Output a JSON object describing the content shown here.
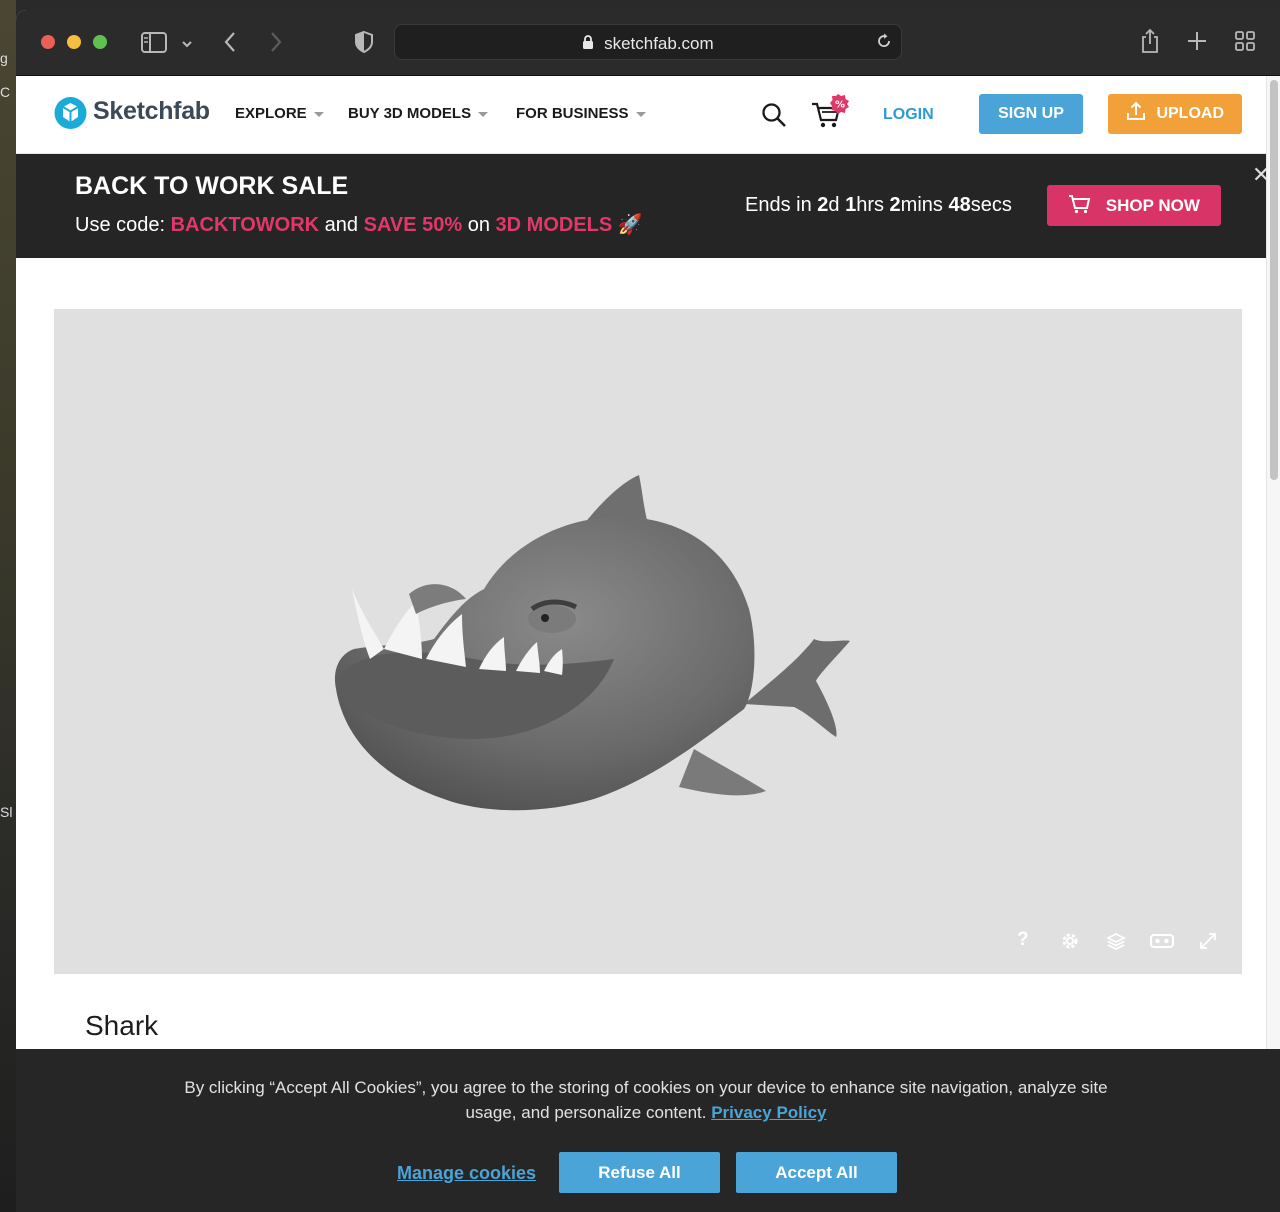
{
  "desktop": {
    "fragments": [
      "g",
      "C",
      "Sl"
    ]
  },
  "browser": {
    "url": "sketchfab.com",
    "colors": {
      "close": "#ec5f57",
      "minimize": "#f5be3f",
      "zoom": "#5fc24f"
    }
  },
  "header": {
    "logo_text": "Sketchfab",
    "nav": [
      {
        "label": "EXPLORE"
      },
      {
        "label": "BUY 3D MODELS"
      },
      {
        "label": "FOR BUSINESS"
      }
    ],
    "login_label": "LOGIN",
    "signup_label": "SIGN UP",
    "upload_label": "UPLOAD",
    "cart_badge": "%"
  },
  "banner": {
    "title": "BACK TO WORK SALE",
    "code_prefix": "Use code: ",
    "code": "BACKTOWORK",
    "mid": " and ",
    "save": "SAVE 50%",
    "on": " on ",
    "target": "3D MODELS",
    "emoji": "🚀",
    "countdown": {
      "prefix": "Ends in ",
      "days": "2",
      "days_unit": "d ",
      "hours": "1",
      "hours_unit": "hrs ",
      "mins": "2",
      "mins_unit": "mins ",
      "secs": "48",
      "secs_unit": "secs"
    },
    "shop_label": "SHOP NOW",
    "close": "✕"
  },
  "viewer": {
    "help": "?"
  },
  "model": {
    "title": "Shark"
  },
  "cookie": {
    "message": "By clicking “Accept All Cookies”, you agree to the storing of cookies on your device to enhance site navigation, analyze site usage, and personalize content.",
    "privacy_label": "Privacy Policy",
    "manage_label": "Manage cookies",
    "refuse_label": "Refuse All",
    "accept_label": "Accept All"
  },
  "colors": {
    "brand_blue": "#4ba4d8",
    "upload_orange": "#f2a03a",
    "sale_pink": "#d93467"
  }
}
